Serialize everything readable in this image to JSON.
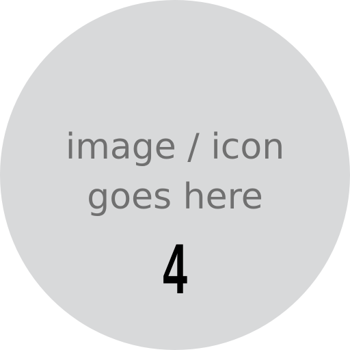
{
  "placeholder": {
    "line1": "image / icon",
    "line2": "goes here",
    "number": "4",
    "colors": {
      "circle": "#d8d9da",
      "caption": "#707070",
      "number": "#000000",
      "background": "#ffffff"
    }
  }
}
